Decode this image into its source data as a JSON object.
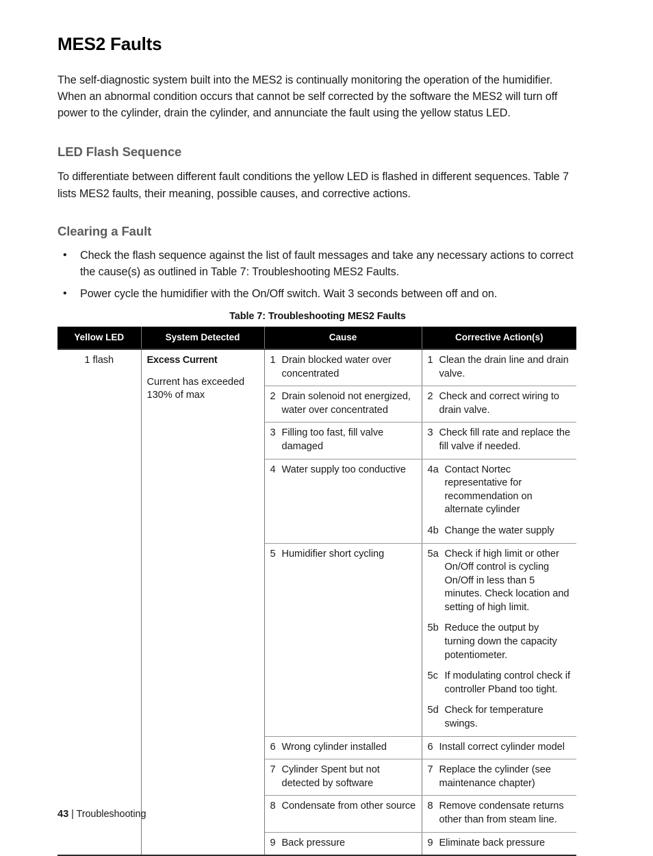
{
  "document": {
    "title": "MES2 Faults",
    "intro": "The self-diagnostic system built into the MES2 is continually monitoring the operation of the humidifier.  When an abnormal condition occurs that cannot be self corrected by the software the MES2 will turn off power to the cylinder, drain the cylinder, and annunciate the fault using the yellow status LED.",
    "sections": [
      {
        "heading": "LED Flash Sequence",
        "text": "To differentiate between different fault conditions the yellow LED is flashed in different sequences.  Table 7 lists MES2 faults, their meaning, possible causes, and corrective actions."
      },
      {
        "heading": "Clearing a Fault",
        "bullets": [
          "Check the flash sequence against the list of fault messages and take any necessary actions to correct the cause(s) as outlined in Table 7: Troubleshooting MES2 Faults.",
          "Power cycle the humidifier with the On/Off switch. Wait 3 seconds between off and on."
        ]
      }
    ]
  },
  "table": {
    "caption": "Table 7: Troubleshooting MES2 Faults",
    "headers": [
      "Yellow LED",
      "System Detected",
      "Cause",
      "Corrective Action(s)"
    ],
    "led": "1 flash",
    "system_detected": {
      "title": "Excess Current",
      "description": "Current has exceeded 130% of max"
    },
    "rows": [
      {
        "cause_num": "1",
        "cause_text": "Drain blocked water over concentrated",
        "actions": [
          {
            "num": "1",
            "text": "Clean the drain line and drain valve."
          }
        ]
      },
      {
        "cause_num": "2",
        "cause_text": "Drain solenoid not energized, water over concentrated",
        "actions": [
          {
            "num": "2",
            "text": "Check and correct wiring to drain valve."
          }
        ]
      },
      {
        "cause_num": "3",
        "cause_text": "Filling too fast, fill valve damaged",
        "actions": [
          {
            "num": "3",
            "text": "Check fill rate and replace the fill valve if needed."
          }
        ]
      },
      {
        "cause_num": "4",
        "cause_text": "Water supply too conductive",
        "actions": [
          {
            "num": "4a",
            "text": "Contact Nortec representative for recommendation on alternate cylinder"
          },
          {
            "num": "4b",
            "text": "Change the water supply"
          }
        ]
      },
      {
        "cause_num": "5",
        "cause_text": "Humidifier short cycling",
        "actions": [
          {
            "num": "5a",
            "text": "Check if high limit or other On/Off control is cycling On/Off in less than 5 minutes.  Check location and setting of high limit."
          },
          {
            "num": "5b",
            "text": "Reduce the output by turning down the capacity potentiometer."
          },
          {
            "num": "5c",
            "text": "If modulating control check if controller Pband too tight."
          },
          {
            "num": "5d",
            "text": "Check for temperature swings."
          }
        ]
      },
      {
        "cause_num": "6",
        "cause_text": "Wrong cylinder installed",
        "actions": [
          {
            "num": "6",
            "text": "Install correct cylinder model"
          }
        ]
      },
      {
        "cause_num": "7",
        "cause_text": "Cylinder Spent but not detected by software",
        "actions": [
          {
            "num": "7",
            "text": "Replace the cylinder (see maintenance chapter)"
          }
        ]
      },
      {
        "cause_num": "8",
        "cause_text": "Condensate from other source",
        "actions": [
          {
            "num": "8",
            "text": "Remove condensate returns other than from steam line."
          }
        ]
      },
      {
        "cause_num": "9",
        "cause_text": "Back pressure",
        "actions": [
          {
            "num": "9",
            "text": "Eliminate back pressure"
          }
        ]
      }
    ]
  },
  "footer": {
    "page_number": "43",
    "separator": "|",
    "chapter": "Troubleshooting"
  }
}
